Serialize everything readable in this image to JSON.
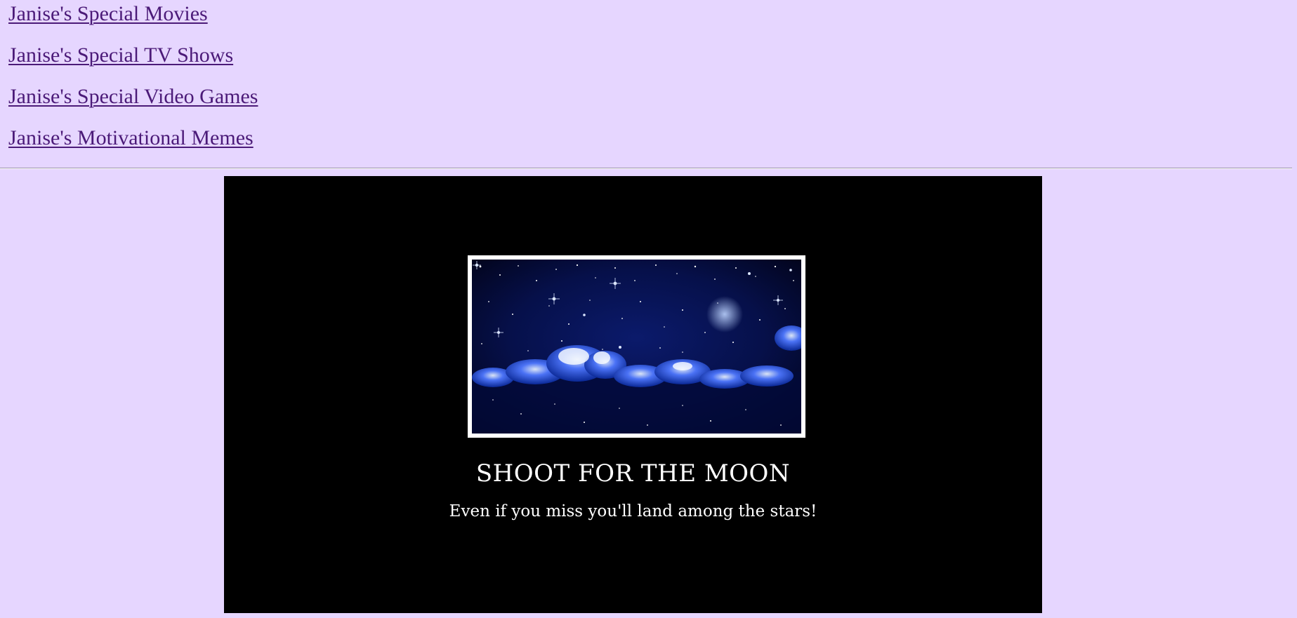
{
  "nav": {
    "links": [
      {
        "label": "Janise's Special Movies"
      },
      {
        "label": "Janise's Special TV Shows"
      },
      {
        "label": "Janise's Special Video Games"
      },
      {
        "label": "Janise's Motivational Memes"
      }
    ]
  },
  "meme": {
    "title": "SHOOT FOR THE MOON",
    "caption": "Even if you miss you'll land among the stars!",
    "image": {
      "subject": "night-sky-crescent-moon"
    }
  },
  "colors": {
    "page_background": "#e6d6ff",
    "link": "#4b1a78",
    "poster_background": "#000000",
    "poster_text": "#ffffff",
    "frame_border": "#ffffff"
  }
}
